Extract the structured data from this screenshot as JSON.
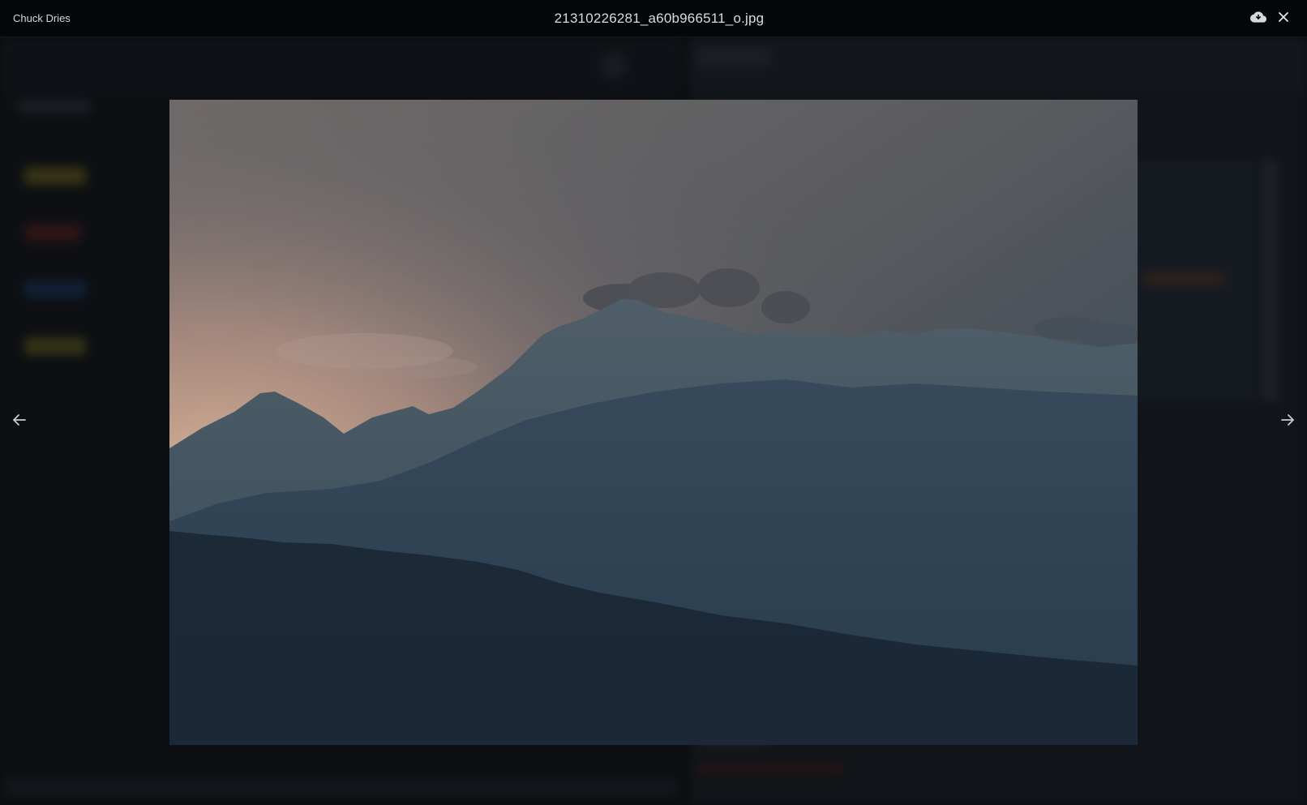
{
  "topbar": {
    "owner": "Chuck Dries",
    "filename": "21310226281_a60b966511_o.jpg",
    "download_icon": "cloud-download-icon",
    "close_icon": "close-icon"
  },
  "photo": {
    "alt": "21310226281_a60b966511_o.jpg"
  },
  "navigation": {
    "prev_icon": "arrow-left-icon",
    "next_icon": "arrow-right-icon"
  },
  "colors": {
    "topbar_bg": "#050607",
    "overlay_bg": "#0b0d10",
    "text": "#d9dbde"
  }
}
